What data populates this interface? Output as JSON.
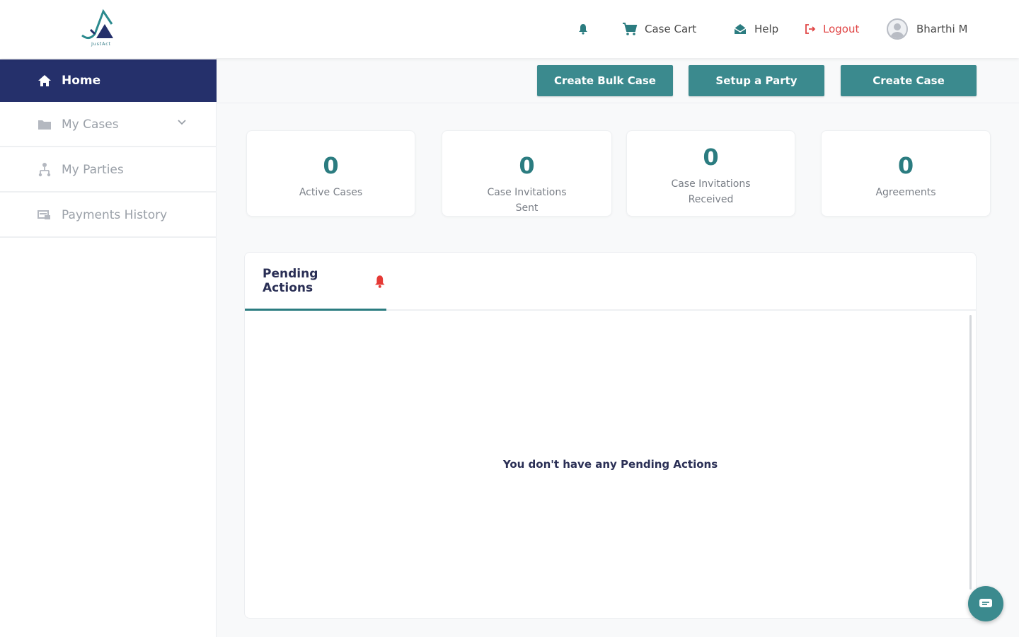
{
  "header": {
    "logo_text": "JustAct",
    "nav": {
      "notifications_icon": "bell-icon",
      "case_cart": "Case Cart",
      "help": "Help",
      "logout": "Logout",
      "user_name": "Bharthi M"
    }
  },
  "sidebar": {
    "items": [
      {
        "label": "Home",
        "icon": "home-icon",
        "active": true
      },
      {
        "label": "My Cases",
        "icon": "folder-icon",
        "expandable": true
      },
      {
        "label": "My Parties",
        "icon": "parties-icon"
      },
      {
        "label": "Payments History",
        "icon": "payments-icon"
      }
    ]
  },
  "actions": {
    "create_bulk_case": "Create Bulk Case",
    "setup_party": "Setup a Party",
    "create_case": "Create Case"
  },
  "stats": [
    {
      "value": "0",
      "label": "Active Cases"
    },
    {
      "value": "0",
      "label": "Case Invitations Sent"
    },
    {
      "value": "0",
      "label": "Case Invitations Received"
    },
    {
      "value": "0",
      "label": "Agreements"
    }
  ],
  "pending": {
    "tab_label": "Pending Actions",
    "empty_message": "You don't have any Pending Actions"
  },
  "colors": {
    "primary_navy": "#25306b",
    "teal": "#3b8a8e",
    "logout_red": "#e04545",
    "alert_red": "#e53935"
  }
}
